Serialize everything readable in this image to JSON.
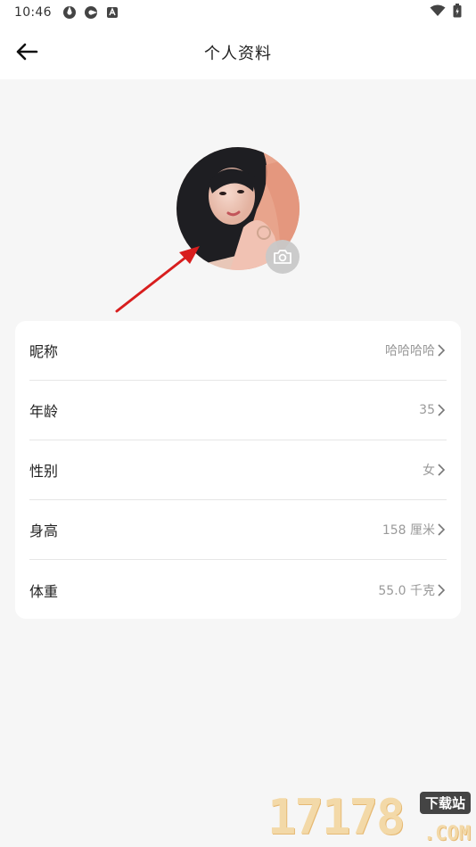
{
  "status_bar": {
    "time": "10:46",
    "icons": [
      "app-icon-1",
      "app-icon-2",
      "notification-icon"
    ],
    "right_icons": [
      "wifi-icon",
      "battery-icon"
    ]
  },
  "header": {
    "title": "个人资料",
    "back_icon": "arrow-left-icon"
  },
  "avatar": {
    "camera_icon": "camera-icon"
  },
  "profile": {
    "rows": [
      {
        "label": "昵称",
        "value": "哈哈哈哈"
      },
      {
        "label": "年龄",
        "value": "35"
      },
      {
        "label": "性别",
        "value": "女"
      },
      {
        "label": "身高",
        "value": "158 厘米"
      },
      {
        "label": "体重",
        "value": "55.0 千克"
      }
    ]
  },
  "watermark": {
    "number": "17178",
    "badge": "下载站",
    "domain": ".COM"
  },
  "colors": {
    "background": "#f6f6f6",
    "card": "#ffffff",
    "value_text": "#9a9a9a",
    "arrow_red": "#d81e1e"
  }
}
